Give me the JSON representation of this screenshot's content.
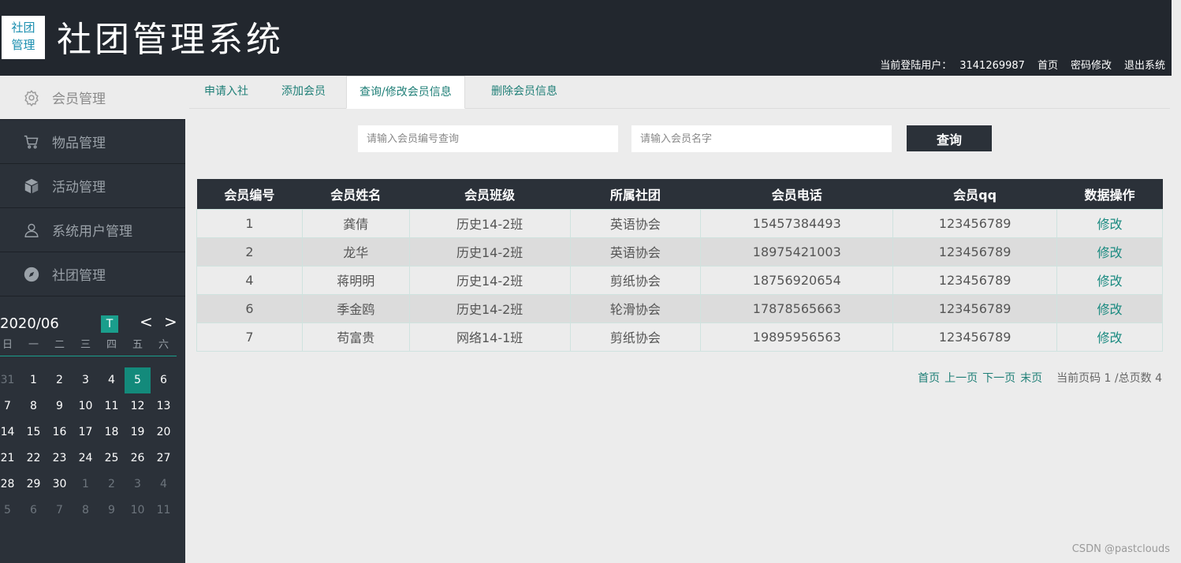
{
  "header": {
    "logo_line1": "社团",
    "logo_line2": "管理",
    "title": "社团管理系统",
    "login_label": "当前登陆用户：",
    "user_id": "3141269987",
    "home_link": "首页",
    "password_link": "密码修改",
    "logout_link": "退出系统"
  },
  "sidebar": {
    "items": [
      {
        "label": "会员管理",
        "icon": "gear-icon"
      },
      {
        "label": "物品管理",
        "icon": "cart-icon"
      },
      {
        "label": "活动管理",
        "icon": "box-icon"
      },
      {
        "label": "系统用户管理",
        "icon": "user-icon"
      },
      {
        "label": "社团管理",
        "icon": "compass-icon"
      }
    ]
  },
  "calendar": {
    "month": "2020/06",
    "today_label": "T",
    "prev": "<",
    "next": ">",
    "weekdays": [
      "日",
      "一",
      "二",
      "三",
      "四",
      "五",
      "六"
    ],
    "days": [
      {
        "d": "31",
        "m": true
      },
      {
        "d": "1"
      },
      {
        "d": "2"
      },
      {
        "d": "3"
      },
      {
        "d": "4"
      },
      {
        "d": "5",
        "s": true
      },
      {
        "d": "6"
      },
      {
        "d": "7"
      },
      {
        "d": "8"
      },
      {
        "d": "9"
      },
      {
        "d": "10"
      },
      {
        "d": "11"
      },
      {
        "d": "12"
      },
      {
        "d": "13"
      },
      {
        "d": "14"
      },
      {
        "d": "15"
      },
      {
        "d": "16"
      },
      {
        "d": "17"
      },
      {
        "d": "18"
      },
      {
        "d": "19"
      },
      {
        "d": "20"
      },
      {
        "d": "21"
      },
      {
        "d": "22"
      },
      {
        "d": "23"
      },
      {
        "d": "24"
      },
      {
        "d": "25"
      },
      {
        "d": "26"
      },
      {
        "d": "27"
      },
      {
        "d": "28"
      },
      {
        "d": "29"
      },
      {
        "d": "30"
      },
      {
        "d": "1",
        "m": true
      },
      {
        "d": "2",
        "m": true
      },
      {
        "d": "3",
        "m": true
      },
      {
        "d": "4",
        "m": true
      },
      {
        "d": "5",
        "m": true
      },
      {
        "d": "6",
        "m": true
      },
      {
        "d": "7",
        "m": true
      },
      {
        "d": "8",
        "m": true
      },
      {
        "d": "9",
        "m": true
      },
      {
        "d": "10",
        "m": true
      },
      {
        "d": "11",
        "m": true
      }
    ]
  },
  "tabs": [
    {
      "label": "申请入社"
    },
    {
      "label": "添加会员"
    },
    {
      "label": "查询/修改会员信息"
    },
    {
      "label": "删除会员信息"
    }
  ],
  "search": {
    "id_placeholder": "请输入会员编号查询",
    "name_placeholder": "请输入会员名字",
    "button": "查询"
  },
  "table": {
    "headers": [
      "会员编号",
      "会员姓名",
      "会员班级",
      "所属社团",
      "会员电话",
      "会员qq",
      "数据操作"
    ],
    "rows": [
      [
        "1",
        "龚倩",
        "历史14-2班",
        "英语协会",
        "15457384493",
        "123456789",
        "修改"
      ],
      [
        "2",
        "龙华",
        "历史14-2班",
        "英语协会",
        "18975421003",
        "123456789",
        "修改"
      ],
      [
        "4",
        "蒋明明",
        "历史14-2班",
        "剪纸协会",
        "18756920654",
        "123456789",
        "修改"
      ],
      [
        "6",
        "季金鸥",
        "历史14-2班",
        "轮滑协会",
        "17878565663",
        "123456789",
        "修改"
      ],
      [
        "7",
        "苟富贵",
        "网络14-1班",
        "剪纸协会",
        "19895956563",
        "123456789",
        "修改"
      ]
    ]
  },
  "pager": {
    "first": "首页",
    "prev": "上一页",
    "next": "下一页",
    "last": "末页",
    "info": "当前页码 1 /总页数 4"
  },
  "watermark": "CSDN @pastclouds",
  "colors": {
    "header_bg": "#22272e",
    "sidebar_bg": "#2b3139",
    "accent": "#1a9e8c",
    "link": "#1f7f77"
  }
}
